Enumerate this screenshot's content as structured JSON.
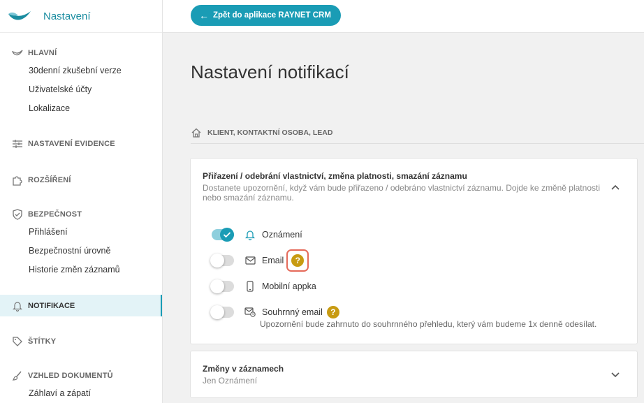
{
  "app": {
    "title": "Nastavení"
  },
  "sidebar": {
    "sections": [
      {
        "label": "HLAVNÍ",
        "icon": "raynet-logo-icon",
        "items": [
          "30denní zkušební verze",
          "Uživatelské účty",
          "Lokalizace"
        ]
      },
      {
        "label": "NASTAVENÍ EVIDENCE",
        "icon": "sliders-icon",
        "items": []
      },
      {
        "label": "ROZŠÍŘENÍ",
        "icon": "puzzle-icon",
        "items": []
      },
      {
        "label": "BEZPEČNOST",
        "icon": "shield-icon",
        "items": [
          "Přihlášení",
          "Bezpečnostní úrovně",
          "Historie změn záznamů"
        ]
      },
      {
        "label": "NOTIFIKACE",
        "icon": "bell-icon",
        "items": []
      },
      {
        "label": "ŠTÍTKY",
        "icon": "tag-icon",
        "items": []
      },
      {
        "label": "VZHLED DOKUMENTŮ",
        "icon": "brush-icon",
        "items": [
          "Záhlaví a zápatí"
        ]
      }
    ],
    "active": "NOTIFIKACE"
  },
  "topbar": {
    "back_label": "Zpět do aplikace RAYNET CRM"
  },
  "main": {
    "title": "Nastavení notifikací",
    "breadcrumb": "KLIENT, KONTAKTNÍ OSOBA, LEAD",
    "card1": {
      "title": "Přiřazení / odebrání vlastnictví, změna platnosti, smazání záznamu",
      "description": "Dostanete upozornění, když vám bude přiřazeno / odebráno vlastnictví záznamu. Dojde ke změně platnosti nebo smazání záznamu.",
      "channels": [
        {
          "label": "Oznámení",
          "icon": "bell-icon",
          "enabled": true
        },
        {
          "label": "Email",
          "icon": "envelope-icon",
          "enabled": false
        },
        {
          "label": "Mobilní appka",
          "icon": "phone-icon",
          "enabled": false
        },
        {
          "label": "Souhrnný email",
          "icon": "envelope-clock-icon",
          "enabled": false
        }
      ],
      "summary_note": "Upozornění bude zahrnuto do souhrnného přehledu, který vám budeme 1x denně odesílat."
    },
    "card2": {
      "title": "Změny v záznamech",
      "subtitle": "Jen Oznámení"
    },
    "help_glyph": "?"
  },
  "colors": {
    "accent": "#1a9cb5",
    "help": "#c89b12",
    "highlight": "#e56a5a"
  }
}
